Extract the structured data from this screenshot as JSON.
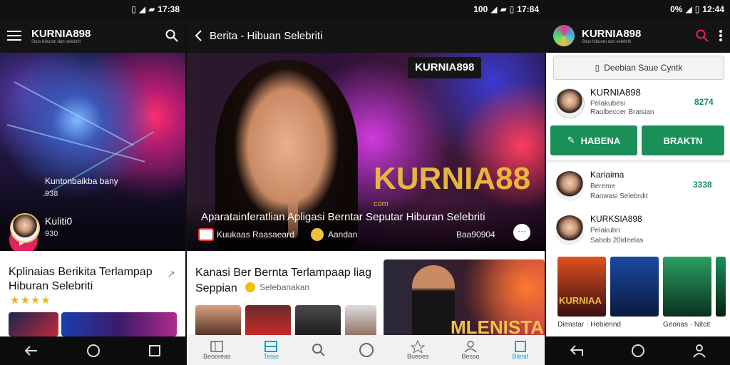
{
  "screen1": {
    "status_time": "17:38",
    "app_title": "KURNIA898",
    "app_subtitle": "Situs hiburan dan selebriti",
    "hero_title": "Kuntonbaikba bany",
    "hero_sub": "938",
    "user_name": "Kuliti0",
    "user_count": "930",
    "card_title": "Kplinaias Berikita Terlampap Hiburan Selebriti",
    "stars": "★★★★"
  },
  "screen2": {
    "status_time": "17:84",
    "status_prefix": "100",
    "page_title": "Berita - Hibuan Selebriti",
    "logo_text": "KURNIA898",
    "brand_overlay": "KURNIA88",
    "brand_suffix": "com",
    "headline": "Aparatainferatlian Apligasi Berntar Seputar Hiburan Selebriti",
    "source_label": "Kuukaas Raasaeard",
    "author": "Aandan",
    "timestamp": "Baa90904",
    "card_title": "Kanasi Ber Bernta Terlampaap liag Seppian",
    "card_meta": "Selebanakan",
    "promo_text": "MLENISTA",
    "nav": [
      "Beooreas",
      "Tenio",
      "",
      "",
      "Bueoes",
      "Besso",
      "Blenit"
    ]
  },
  "screen3": {
    "status_time": "12:44",
    "status_prefix": "0%",
    "app_title": "KURNIA898",
    "app_subtitle": "Situs hiburan dan selebriti",
    "search_pill": "Deebian Saue Cyntk",
    "profile_name": "KURNIA898",
    "profile_line1": "Pelakubesi",
    "profile_line2": "Raolbeccer Braisian",
    "profile_score": "8274",
    "btn_left": "HABENA",
    "btn_right": "BRAKTN",
    "item1_name": "Kariaima",
    "item1_line1": "Bereme",
    "item1_line2": "Raowasi Selebrdit",
    "item1_score": "3338",
    "item2_name": "KURKSIA898",
    "item2_line1": "Pelakubn",
    "item2_line2": "Sabob 20ideelas",
    "thumb_brand": "KURNIAA",
    "bottom_left": "Dienstar · Hebiennd",
    "bottom_right": "Geonas · Nitcit"
  }
}
